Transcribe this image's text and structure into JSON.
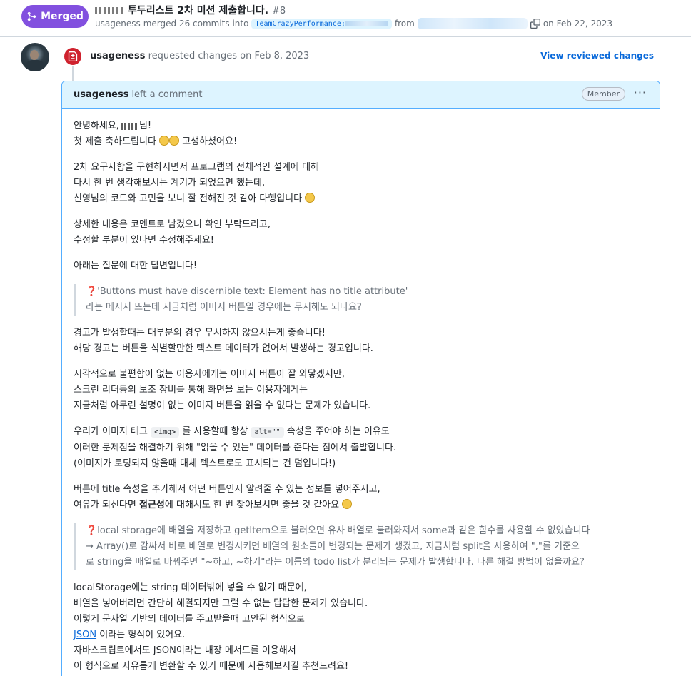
{
  "pr": {
    "status": "Merged",
    "title": "투두리스트 2차 미션 제출합니다.",
    "number": "#8",
    "author": "usageness",
    "merged_text": "merged 26 commits into",
    "base_branch_prefix": "TeamCrazyPerformance:",
    "from_text": "from",
    "date_text": "on Feb 22, 2023"
  },
  "review": {
    "reviewer": "usageness",
    "action_text": "requested changes on Feb 8, 2023",
    "view_changes": "View reviewed changes"
  },
  "comment": {
    "author": "usageness",
    "action": "left a comment",
    "role_badge": "Member",
    "menu": "···",
    "greeting_prefix": "안녕하세요,",
    "greeting_suffix": "님!",
    "congrats_1": "첫 제출 축하드립니다",
    "congrats_2": "고생하셨어요!",
    "p2_1": "2차 요구사항을 구현하시면서 프로그램의 전체적인 설계에 대해",
    "p2_2": "다시 한 번 생각해보시는 계기가 되었으면 했는데,",
    "p2_3": "신영님의 코드와 고민을 보니 잘 전해진 것 같아 다행입니다",
    "p3_1": "상세한 내용은 코멘트로 남겼으니 확인 부탁드리고,",
    "p3_2": "수정할 부분이 있다면 수정해주세요!",
    "p4": "아래는 질문에 대한 답변입니다!",
    "q1_mark": "❓",
    "q1_1": "'Buttons must have discernible text: Element has no title attribute'",
    "q1_2": "라는 메시지 뜨는데 지금처럼 이미지 버튼일 경우에는 무시해도 되나요?",
    "a1_1": "경고가 발생할때는 대부분의 경우 무시하지 않으시는게 좋습니다!",
    "a1_2": "해당 경고는 버튼을 식별할만한 텍스트 데이터가 없어서 발생하는 경고입니다.",
    "a2_1": "시각적으로 불편함이 없는 이용자에게는 이미지 버튼이 잘 와닿겠지만,",
    "a2_2": "스크린 리더등의 보조 장비를 통해 화면을 보는 이용자에게는",
    "a2_3": "지금처럼 아무런 설명이 없는 이미지 버튼을 읽을 수 없다는 문제가 있습니다.",
    "a3_1a": "우리가 이미지 태그",
    "a3_code1": "<img>",
    "a3_1b": "를 사용할때 항상",
    "a3_code2": "alt=\"\"",
    "a3_1c": "속성을 주어야 하는 이유도",
    "a3_2": "이러한 문제점을 해결하기 위해 \"읽을 수 있는\" 데이터를 준다는 점에서 출발합니다.",
    "a3_3": "(이미지가 로딩되지 않을때 대체 텍스트로도 표시되는 건 덤입니다!)",
    "a4_1": "버튼에 title 속성을 추가해서 어떤 버튼인지 알려줄 수 있는 정보를 넣어주시고,",
    "a4_2a": "여유가 되신다면",
    "a4_2b": "접근성",
    "a4_2c": "에 대해서도 한 번 찾아보시면 좋을 것 같아요",
    "q2_mark": "❓",
    "q2_1": "local storage에 배열을 저장하고 getItem으로 불러오면 유사 배열로 불러와져서 some과 같은 함수를 사용할 수 없었습니다",
    "q2_2": "→ Array()로 감싸서 바로 배열로 변경시키면 배열의 원소들이 변경되는 문제가 생겼고, 지금처럼 split을 사용하여 \",\"를 기준으",
    "q2_3": "로 string을 배열로 바꿔주면 \"~하고, ~하기\"라는 이름의 todo list가 분리되는 문제가 발생합니다. 다른 해결 방법이 없을까요?",
    "a5_1": "localStorage에는 string 데이터밖에 넣을 수 없기 때문에,",
    "a5_2": "배열을 넣어버리면 간단히 해결되지만 그럴 수 없는 답답한 문제가 있습니다.",
    "a5_3": "이렇게 문자열 기반의 데이터를 주고받을때 고안된 형식으로",
    "a5_4_link": "JSON",
    "a5_4_rest": "이라는 형식이 있어요.",
    "a5_5": "자바스크립트에서도 JSON이라는 내장 메서드를 이용해서",
    "a5_6": "이 형식으로 자유롭게 변환할 수 있기 때문에 사용해보시길 추천드려요!"
  },
  "colors": {
    "merged": "#8250df",
    "link": "#0969da",
    "comment_border": "#54aeff",
    "comment_header_bg": "#ddf4ff",
    "request_changes": "#cf222e"
  },
  "icons": [
    "merge-icon",
    "copy-icon",
    "file-diff-icon",
    "avatar",
    "kebab-icon"
  ]
}
